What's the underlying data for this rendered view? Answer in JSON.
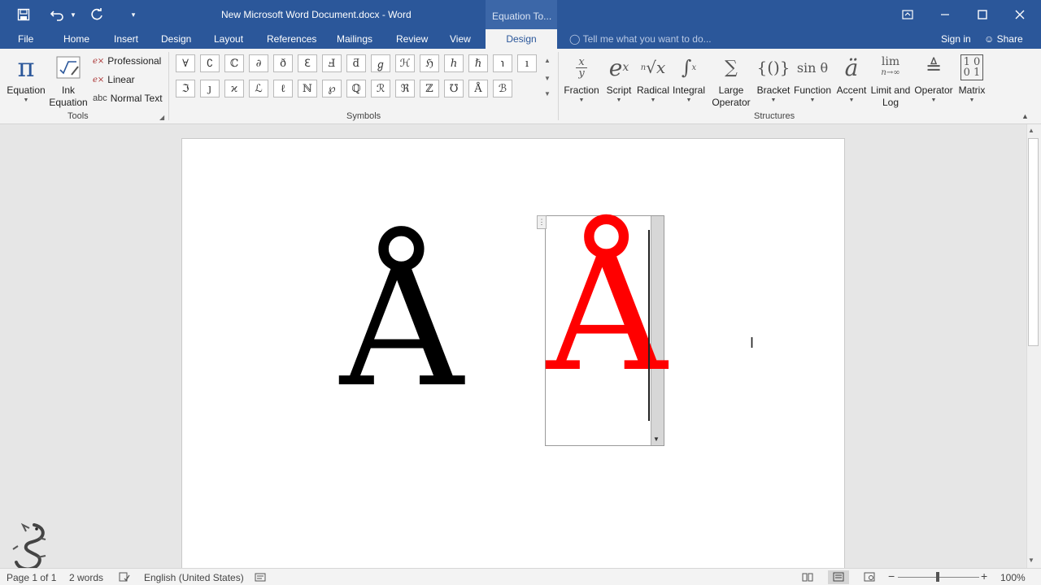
{
  "window": {
    "doc_title": "New Microsoft Word Document.docx - Word",
    "context_tab": "Equation To...",
    "icons": [
      "save-icon",
      "undo-icon",
      "redo-icon",
      "customize-qat-icon",
      "ribbon-display-icon",
      "minimize-icon",
      "maximize-icon",
      "close-icon"
    ]
  },
  "tabs": [
    "File",
    "Home",
    "Insert",
    "Design",
    "Layout",
    "References",
    "Mailings",
    "Review",
    "View",
    "Design"
  ],
  "active_tab": "Design",
  "tell_me": "Tell me what you want to do...",
  "sign_in": "Sign in",
  "share": "Share",
  "ribbon": {
    "tools": {
      "label": "Tools",
      "equation": "Equation",
      "ink_equation": "Ink Equation",
      "professional": "Professional",
      "linear": "Linear",
      "normal_text": "Normal Text",
      "normal_text_prefix": "abc"
    },
    "symbols": {
      "label": "Symbols",
      "row1": [
        "∀",
        "∁",
        "ℂ",
        "∂",
        "ð",
        "ℇ",
        "Ⅎ",
        "ƌ",
        "ℊ",
        "ℋ",
        "ℌ",
        "ℎ",
        "ℏ",
        "℩",
        "ı"
      ],
      "row2": [
        "ℑ",
        "ȷ",
        "ϰ",
        "ℒ",
        "ℓ",
        "ℕ",
        "℘",
        "ℚ",
        "ℛ",
        "ℜ",
        "ℤ",
        "℧",
        "Å",
        "ℬ"
      ]
    },
    "structures": {
      "label": "Structures",
      "items": [
        "Fraction",
        "Script",
        "Radical",
        "Integral",
        "Large Operator",
        "Bracket",
        "Function",
        "Accent",
        "Limit and Log",
        "Operator",
        "Matrix"
      ]
    }
  },
  "document": {
    "left_char": "Å",
    "right_char": "Å",
    "right_color": "#ff0000"
  },
  "status": {
    "page": "Page 1 of 1",
    "words": "2 words",
    "language": "English (United States)",
    "zoom": "100%"
  }
}
